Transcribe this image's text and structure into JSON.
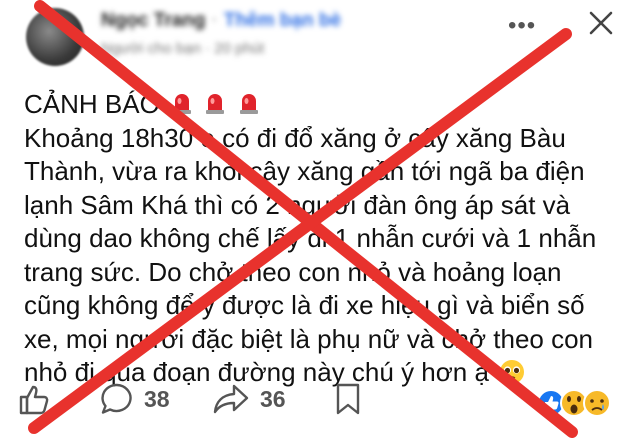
{
  "post": {
    "author_name": "Ngọc Trang",
    "separator": "·",
    "friend_action": "Thêm bạn bè",
    "sub_info": "Người cho bạn · 20 phút",
    "title": "CẢNH BÁO",
    "lines": [
      "Khoảng 18h30 e có đi đổ xăng ở cây xăng Bàu",
      "Thành, vừa ra khỏi cây xăng gần tới ngã ba điện",
      "lạnh Sâm Khá thì có 2 người đàn ông áp sát và",
      "dùng dao không chế lấy đi 1 nhẫn cưới và 1 nhẫn",
      "trang sức. Do chở theo con nhỏ và hoảng loạn",
      "cũng không để ý được là đi xe hiệu gì và biển số",
      "xe, mọi người đặc biệt là phụ nữ và chở theo con",
      "nhỏ đi qua đoạn đường này chú ý hơn ạ"
    ]
  },
  "header": {
    "more_label": "•••"
  },
  "actions": {
    "comments_count": "38",
    "shares_count": "36"
  },
  "icons": {
    "siren": "siren-icon",
    "pleading": "pleading-face-icon",
    "like": "like-icon",
    "comment": "comment-icon",
    "share": "share-icon",
    "save": "bookmark-icon",
    "close": "close-icon",
    "reactions": [
      "like-reaction-icon",
      "wow-reaction-icon",
      "sad-reaction-icon"
    ]
  },
  "colors": {
    "cross": "#e8322d",
    "friend_link": "#2f6fe4",
    "like_blue": "#1877f2",
    "siren_red": "#e0232b"
  }
}
